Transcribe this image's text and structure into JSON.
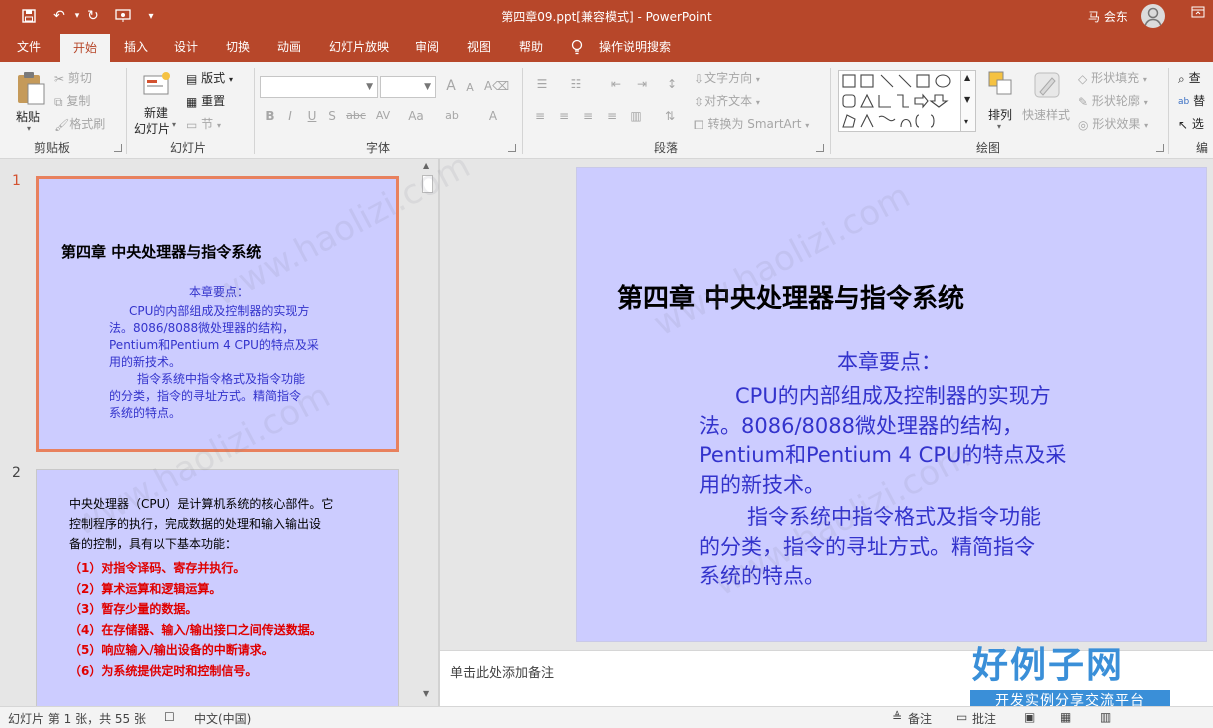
{
  "app": {
    "document_title": "第四章09.ppt[兼容模式]  -  PowerPoint",
    "user_name": "马 会东"
  },
  "tabs": [
    "文件",
    "开始",
    "插入",
    "设计",
    "切换",
    "动画",
    "幻灯片放映",
    "审阅",
    "视图",
    "帮助",
    "操作说明搜索"
  ],
  "active_tab": "开始",
  "ribbon": {
    "clipboard": {
      "paste": "粘贴",
      "cut": "剪切",
      "copy": "复制",
      "format_painter": "格式刷",
      "label": "剪贴板"
    },
    "slides": {
      "new_slide_line1": "新建",
      "new_slide_line2": "幻灯片",
      "layout": "版式",
      "reset": "重置",
      "section": "节",
      "label": "幻灯片"
    },
    "font": {
      "label": "字体",
      "bold": "B",
      "italic": "I",
      "underline": "U",
      "strike": "S",
      "shadow": "abc",
      "spacing": "AV",
      "case": "Aa",
      "grow": "A",
      "shrink": "A"
    },
    "paragraph": {
      "text_direction": "文字方向",
      "align_text": "对齐文本",
      "smartart": "转换为 SmartArt",
      "label": "段落"
    },
    "drawing": {
      "arrange": "排列",
      "quick_styles": "快速样式",
      "shape_fill": "形状填充",
      "shape_outline": "形状轮廓",
      "shape_effects": "形状效果",
      "label": "绘图"
    },
    "editing": {
      "find": "查",
      "replace": "替",
      "select": "选",
      "label": "编"
    }
  },
  "slides": [
    {
      "number": "1",
      "title": "第四章   中央处理器与指令系统",
      "subtitle": "本章要点：",
      "para1": [
        "CPU的内部组成及控制器的实现方",
        "法。8086/8088微处理器的结构，",
        "Pentium和Pentium 4 CPU的特点及采",
        "用的新技术。"
      ],
      "para2": [
        "指令系统中指令格式及指令功能",
        "的分类，指令的寻址方式。精简指令",
        "系统的特点。"
      ]
    },
    {
      "number": "2",
      "intro": [
        "中央处理器（CPU）是计算机系统的核心部件。它",
        "控制程序的执行，完成数据的处理和输入输出设",
        "备的控制，具有以下基本功能："
      ],
      "items": [
        "（1）对指令译码、寄存并执行。",
        "（2）算术运算和逻辑运算。",
        "（3）暂存少量的数据。",
        "（4）在存储器、输入/输出接口之间传送数据。",
        "（5）响应输入/输出设备的中断请求。",
        "（6）为系统提供定时和控制信号。"
      ]
    }
  ],
  "notes_placeholder": "单击此处添加备注",
  "status": {
    "slide_info": "幻灯片 第 1 张，共 55 张",
    "language": "中文(中国)",
    "notes": "备注",
    "comments": "批注"
  },
  "watermark": {
    "text": "www.haolizi.com",
    "logo": "好例子网",
    "logo_sub": "开发实例分享交流平台"
  },
  "colors": {
    "accent": "#b7472a",
    "slide_bg": "#ccccff",
    "slide_blue": "#3333cc",
    "slide_red": "#e00000",
    "selection": "#e8815e"
  }
}
